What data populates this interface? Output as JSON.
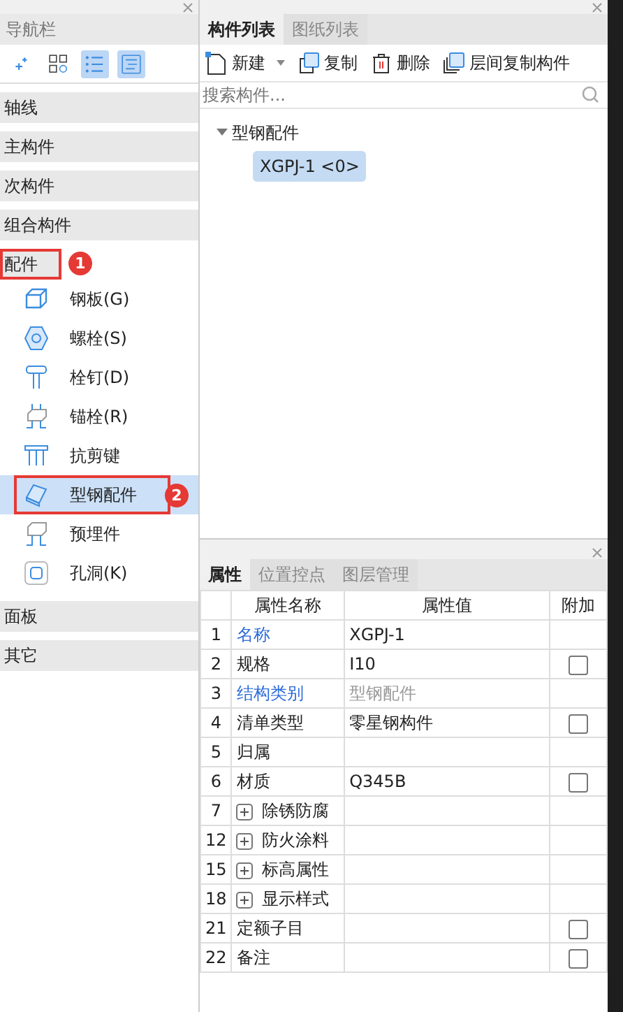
{
  "nav_panel": {
    "title": "导航栏",
    "toolbar": [
      {
        "selected": false
      },
      {
        "selected": false
      },
      {
        "selected": true
      },
      {
        "selected": true
      }
    ],
    "sections": [
      {
        "label": "轴线"
      },
      {
        "label": "主构件"
      },
      {
        "label": "次构件"
      },
      {
        "label": "组合构件"
      },
      {
        "label": "配件",
        "callout": "1",
        "items": [
          {
            "label": "钢板(G)",
            "kind": "plate",
            "selected": false
          },
          {
            "label": "螺栓(S)",
            "kind": "bolt",
            "selected": false
          },
          {
            "label": "栓钉(D)",
            "kind": "stud",
            "selected": false
          },
          {
            "label": "锚栓(R)",
            "kind": "anchor",
            "selected": false
          },
          {
            "label": "抗剪键",
            "kind": "shear",
            "selected": false
          },
          {
            "label": "型钢配件",
            "kind": "steel",
            "selected": true,
            "callout": "2"
          },
          {
            "label": "预埋件",
            "kind": "embed",
            "selected": false
          },
          {
            "label": "孔洞(K)",
            "kind": "hole",
            "selected": false
          }
        ]
      },
      {
        "label": "面板"
      },
      {
        "label": "其它"
      }
    ]
  },
  "component_panel": {
    "tabs": [
      {
        "label": "构件列表",
        "selected": true
      },
      {
        "label": "图纸列表",
        "selected": false
      }
    ],
    "toolbar": [
      {
        "label": "新建",
        "kind": "new",
        "dropdown": true
      },
      {
        "label": "复制",
        "kind": "copy"
      },
      {
        "label": "删除",
        "kind": "delete"
      },
      {
        "label": "层间复制构件",
        "kind": "floorcopy"
      }
    ],
    "search": {
      "placeholder": "搜索构件..."
    },
    "tree": [
      {
        "label": "型钢配件",
        "expanded": true,
        "children": [
          {
            "label": "XGPJ-1 <0>",
            "selected": true
          }
        ]
      }
    ]
  },
  "property_panel": {
    "tabs": [
      {
        "label": "属性",
        "selected": true
      },
      {
        "label": "位置控点",
        "selected": false
      },
      {
        "label": "图层管理",
        "selected": false
      }
    ],
    "columns": [
      "属性名称",
      "属性值",
      "附加"
    ],
    "rows": [
      {
        "num": "1",
        "name": "名称",
        "public": true,
        "value": "XGPJ-1"
      },
      {
        "num": "2",
        "name": "规格",
        "public": false,
        "value": "I10",
        "extra": false
      },
      {
        "num": "3",
        "name": "结构类别",
        "public": true,
        "value": "型钢配件",
        "readonly": true
      },
      {
        "num": "4",
        "name": "清单类型",
        "public": false,
        "value": "零星钢构件",
        "extra": false
      },
      {
        "num": "5",
        "name": "归属",
        "public": false
      },
      {
        "num": "6",
        "name": "材质",
        "public": false,
        "value": "Q345B",
        "extra": false
      },
      {
        "num": "7",
        "name": "除锈防腐",
        "public": false,
        "expanded": false
      },
      {
        "num": "12",
        "name": "防火涂料",
        "public": false,
        "expanded": false
      },
      {
        "num": "15",
        "name": "标高属性",
        "public": false,
        "expanded": false
      },
      {
        "num": "18",
        "name": "显示样式",
        "public": false,
        "expanded": false
      },
      {
        "num": "21",
        "name": "定额子目",
        "public": false,
        "extra": false
      },
      {
        "num": "22",
        "name": "备注",
        "public": false,
        "extra": false
      }
    ]
  }
}
